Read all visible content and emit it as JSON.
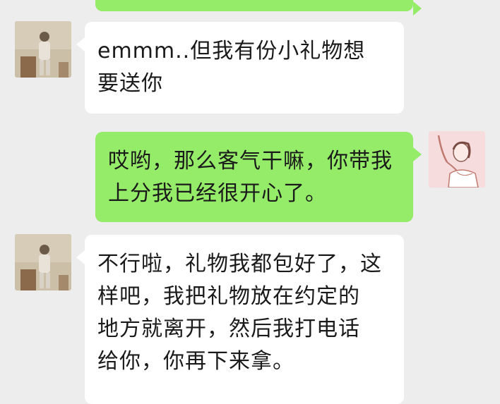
{
  "chat": {
    "messages": [
      {
        "side": "incoming",
        "sender_avatar": "man-standing-avatar",
        "lines": [
          "emmm..但我有份小礼物想",
          "要送你"
        ]
      },
      {
        "side": "outgoing",
        "sender_avatar": "woman-sketch-avatar",
        "lines": [
          "哎哟，那么客气干嘛，你带我",
          "上分我已经很开心了。"
        ]
      },
      {
        "side": "incoming",
        "sender_avatar": "man-standing-avatar",
        "lines": [
          "不行啦，礼物我都包好了，这",
          "样吧，我把礼物放在约定的",
          "地方就离开，然后我打电话",
          "给你，你再下来拿。"
        ]
      }
    ]
  },
  "colors": {
    "background": "#ededed",
    "incoming_bubble": "#ffffff",
    "outgoing_bubble": "#95ec69",
    "text": "#1a1a1a"
  }
}
